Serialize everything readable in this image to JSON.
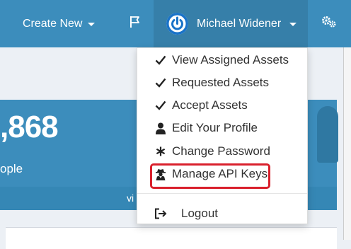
{
  "navbar": {
    "create_new_label": "Create New",
    "flag_icon": "flag-icon",
    "user_name": "Michael Widener",
    "avatar_icon": "power-icon",
    "settings_icon": "gears-icon",
    "colors": {
      "navbar": "#3c8dbc",
      "active": "#367fa9"
    }
  },
  "info_box": {
    "count": ",868",
    "subtitle": "ople",
    "footer_text": "vi"
  },
  "user_menu": {
    "items": [
      {
        "label": "View Assigned Assets",
        "icon": "check-icon"
      },
      {
        "label": "Requested Assets",
        "icon": "check-icon"
      },
      {
        "label": "Accept Assets",
        "icon": "check-icon"
      },
      {
        "label": "Edit Your Profile",
        "icon": "user-icon"
      },
      {
        "label": "Change Password",
        "icon": "asterisk-icon"
      },
      {
        "label": "Manage API Keys",
        "icon": "user-secret-icon"
      }
    ],
    "logout_label": "Logout",
    "logout_icon": "sign-out-icon",
    "highlight_color": "#d9202c"
  }
}
